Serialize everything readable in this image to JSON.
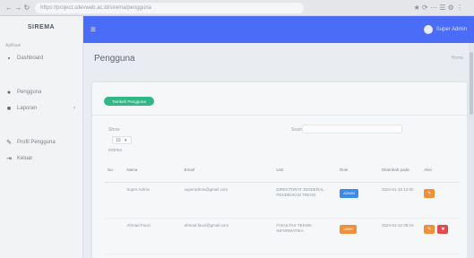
{
  "browser": {
    "nav_icons": "← → ↻",
    "url": "https://project.sdevweb.ac.id/sirema/pengguna",
    "icons": "★ ⟳ ⋯ ☰ ⚙ ⋮"
  },
  "sidebar": {
    "brand": "SIREMA",
    "heading": "Aplikasi",
    "items": [
      {
        "label": "Dashboard",
        "icon": "dashboard-icon",
        "glyph": "▪"
      },
      {
        "label": "Pengguna",
        "icon": "user-icon",
        "glyph": "●"
      },
      {
        "label": "Laporan",
        "icon": "report-icon",
        "glyph": "■",
        "chevron": "›"
      },
      {
        "label": "Profil Pengguna",
        "icon": "profile-icon",
        "glyph": "✎"
      },
      {
        "label": "Keluar",
        "icon": "logout-icon",
        "glyph": "⇥"
      }
    ]
  },
  "topbar": {
    "menu_glyph": "≡",
    "user_name": "Super Admin"
  },
  "page": {
    "title": "Pengguna",
    "breadcrumb": "Home"
  },
  "card": {
    "add_button": "Tambah Pengguna",
    "length_label": "Show",
    "length_value": "10",
    "length_suffix": "entries",
    "search_label": "Search:"
  },
  "table": {
    "headers": [
      "No",
      "Nama",
      "Email",
      "Unit",
      "Role",
      "Ditambah pada",
      "Aksi"
    ],
    "rows": [
      {
        "no": "",
        "nama": "Super Admin",
        "email": "superadmin@gmail.com",
        "unit": "DIREKTORAT JENDERAL PENDIDIKAN TINGGI",
        "role": "ADMIN",
        "role_color": "#3b8bea",
        "date": "2024-01-10 12:00",
        "actions": [
          "edit"
        ]
      },
      {
        "no": "",
        "nama": "Ahmad Fauzi",
        "email": "ahmad.fauzi@gmail.com",
        "unit": "FAKULTAS TEKNIK INFORMATIKA",
        "role": "USER",
        "role_color": "#f0913a",
        "date": "2024-01-12 09:15",
        "actions": [
          "edit",
          "delete"
        ]
      }
    ]
  },
  "colors": {
    "primary": "#4a6cf7",
    "success": "#2fb784",
    "warning": "#f0913a",
    "danger": "#e5484d"
  }
}
